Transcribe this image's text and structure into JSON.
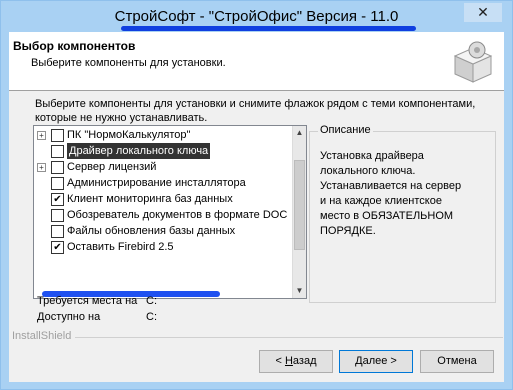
{
  "window": {
    "title": "СтройСофт - \"СтройОфис\" Версия - 11.0",
    "close_glyph": "✕"
  },
  "header": {
    "title": "Выбор компонентов",
    "subtitle": "Выберите компоненты для установки.",
    "icon": "installer-box-icon"
  },
  "instructions": "Выберите компоненты для установки и снимите флажок рядом с теми компонентами, которые не нужно устанавливать.",
  "tree": {
    "items": [
      {
        "label": "ПК \"НормоКалькулятор\"",
        "checked": false,
        "expandable": true,
        "selected": false
      },
      {
        "label": "Драйвер локального ключа",
        "checked": false,
        "expandable": false,
        "selected": true
      },
      {
        "label": "Сервер лицензий",
        "checked": false,
        "expandable": true,
        "selected": false
      },
      {
        "label": "Администрирование инсталлятора",
        "checked": false,
        "expandable": false,
        "selected": false
      },
      {
        "label": "Клиент мониторинга баз данных",
        "checked": true,
        "expandable": false,
        "selected": false
      },
      {
        "label": "Обозреватель документов в формате DOC",
        "checked": false,
        "expandable": false,
        "selected": false
      },
      {
        "label": "Файлы обновления базы данных",
        "checked": false,
        "expandable": false,
        "selected": false
      },
      {
        "label": "Оставить Firebird 2.5",
        "checked": true,
        "expandable": false,
        "selected": false
      }
    ]
  },
  "description": {
    "title": "Описание",
    "text": "Установка драйвера локального ключа. Устанавливается на сервер и на каждое клиентское место в ОБЯЗАТЕЛЬНОМ ПОРЯДКЕ."
  },
  "space": {
    "required_label": "Требуется места на",
    "required_value": "C:",
    "available_label": "Доступно на",
    "available_value": "C:"
  },
  "footer": {
    "brand": "InstallShield"
  },
  "buttons": {
    "back": {
      "prefix": "< ",
      "mnemonic": "Н",
      "rest": "азад"
    },
    "next": {
      "mnemonic": "Д",
      "rest": "алее >"
    },
    "cancel": "Отмена"
  },
  "colors": {
    "title_bar": "#a9d1f3",
    "highlight_marker": "#1f51f0",
    "selection": "#333333"
  }
}
